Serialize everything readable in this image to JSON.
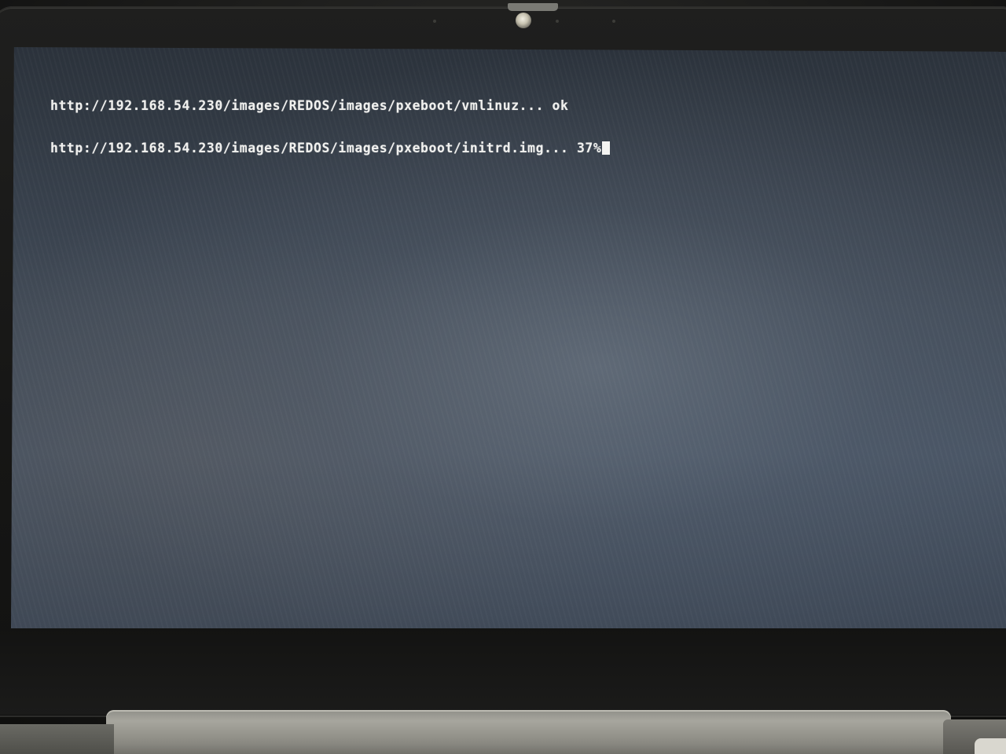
{
  "terminal": {
    "lines": [
      "http://192.168.54.230/images/REDOS/images/pxeboot/vmlinuz... ok",
      "http://192.168.54.230/images/REDOS/images/pxeboot/initrd.img... 37%"
    ]
  },
  "download_progress_percent": 37,
  "colors": {
    "text": "#f0f0ee",
    "screen_background": "#3d4755",
    "bezel": "#161615"
  }
}
